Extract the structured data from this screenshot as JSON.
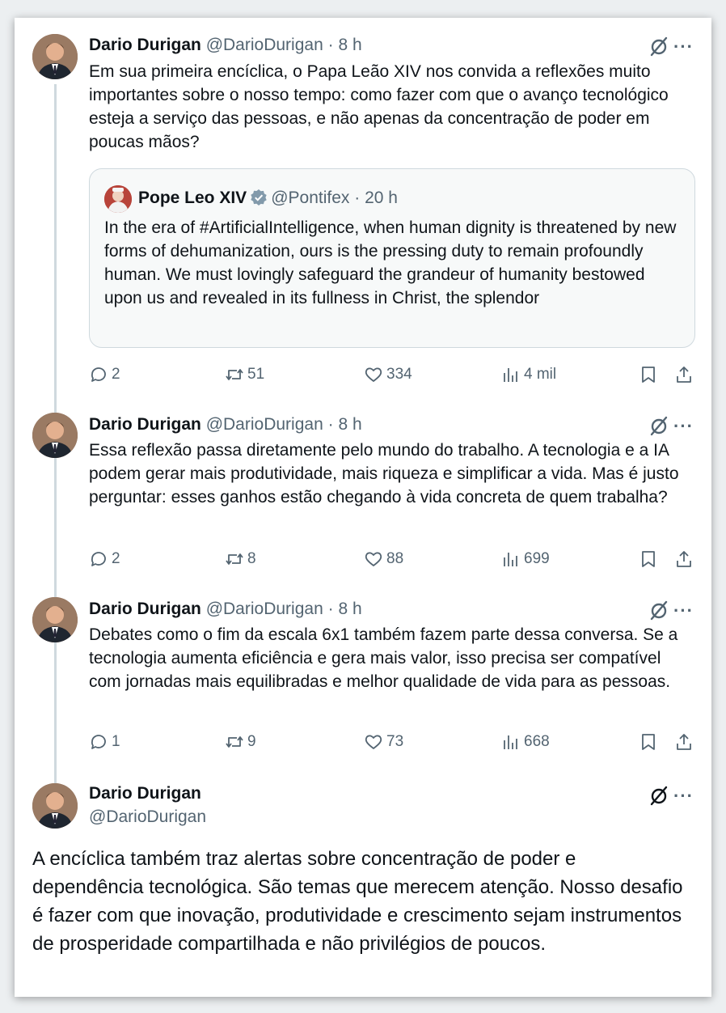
{
  "tweets": [
    {
      "name": "Dario Durigan",
      "handle": "@DarioDurigan",
      "dot": "·",
      "time": "8 h",
      "text": "Em sua primeira encíclica, o Papa Leão XIV nos convida a reflexões muito importantes sobre o nosso tempo: como fazer com que o avanço tecnológico esteja a serviço das pessoas, e não apenas da concentração de poder em poucas mãos?",
      "quote": {
        "name": "Pope Leo XIV",
        "handle": "@Pontifex",
        "dot": "·",
        "time": "20 h",
        "text": "In the era of #ArtificialIntelligence, when human dignity is threatened by new forms of dehumanization, ours is the pressing duty to remain profoundly human. We must lovingly safeguard the grandeur of humanity bestowed upon us and revealed in its fullness in Christ, the splendor"
      },
      "replies": "2",
      "retweets": "51",
      "likes": "334",
      "views": "4 mil"
    },
    {
      "name": "Dario Durigan",
      "handle": "@DarioDurigan",
      "dot": "·",
      "time": "8 h",
      "text": "Essa reflexão passa diretamente pelo mundo do trabalho. A tecnologia e a IA podem gerar mais produtividade, mais riqueza e simplificar a vida. Mas é justo perguntar: esses ganhos estão chegando à vida concreta de quem trabalha?",
      "replies": "2",
      "retweets": "8",
      "likes": "88",
      "views": "699"
    },
    {
      "name": "Dario Durigan",
      "handle": "@DarioDurigan",
      "dot": "·",
      "time": "8 h",
      "text": "Debates como o fim da escala 6x1 também fazem parte dessa conversa. Se a tecnologia aumenta eficiência e gera mais valor, isso precisa ser compatível com jornadas mais equilibradas e melhor qualidade de vida para as pessoas.",
      "replies": "1",
      "retweets": "9",
      "likes": "73",
      "views": "668"
    }
  ],
  "main_tweet": {
    "name": "Dario Durigan",
    "handle": "@DarioDurigan",
    "text": "A encíclica também traz alertas sobre concentração de poder e dependência tecnológica. São temas que merecem atenção. Nosso desafio é fazer com que inovação, produtividade e crescimento sejam instrumentos de prosperidade compartilhada e não privilégios de poucos."
  },
  "more_label": "···",
  "colors": {
    "text": "#0f1419",
    "muted": "#536471",
    "border": "#cfd9de",
    "verified": "#829aab"
  },
  "icons": [
    "grok-icon",
    "more-icon",
    "reply-icon",
    "retweet-icon",
    "like-icon",
    "views-icon",
    "bookmark-icon",
    "share-icon",
    "verified-badge-icon"
  ]
}
